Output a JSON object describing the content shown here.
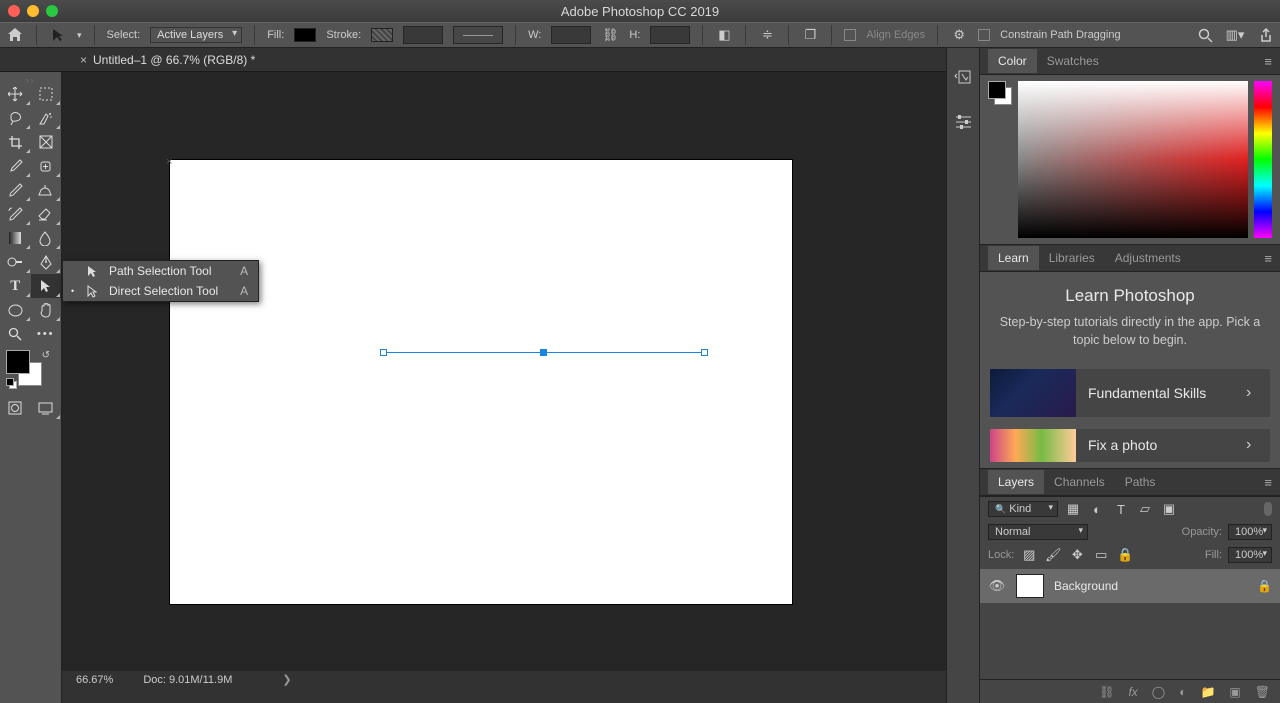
{
  "titlebar": {
    "title": "Adobe Photoshop CC 2019"
  },
  "optionbar": {
    "select_label": "Select:",
    "select_value": "Active Layers",
    "fill_label": "Fill:",
    "stroke_label": "Stroke:",
    "w_label": "W:",
    "h_label": "H:",
    "align_edges": "Align Edges",
    "constrain": "Constrain Path Dragging"
  },
  "doctab": {
    "title": "Untitled–1 @ 66.7% (RGB/8) *"
  },
  "status": {
    "zoom": "66.67%",
    "doc": "Doc: 9.01M/11.9M"
  },
  "flyout": {
    "items": [
      {
        "label": "Path Selection Tool",
        "shortcut": "A",
        "selected": false
      },
      {
        "label": "Direct Selection Tool",
        "shortcut": "A",
        "selected": true
      }
    ]
  },
  "panels": {
    "color_tab": "Color",
    "swatches_tab": "Swatches",
    "learn_tab": "Learn",
    "libraries_tab": "Libraries",
    "adjustments_tab": "Adjustments",
    "layers_tab": "Layers",
    "channels_tab": "Channels",
    "paths_tab": "Paths"
  },
  "learn": {
    "title": "Learn Photoshop",
    "subtitle": "Step-by-step tutorials directly in the app. Pick a topic below to begin.",
    "lessons": [
      {
        "title": "Fundamental Skills"
      },
      {
        "title": "Fix a photo"
      }
    ]
  },
  "layers": {
    "kind": "Kind",
    "blend": "Normal",
    "opacity_label": "Opacity:",
    "opacity_value": "100%",
    "lock_label": "Lock:",
    "fill_label": "Fill:",
    "fill_value": "100%",
    "items": [
      {
        "name": "Background"
      }
    ]
  }
}
